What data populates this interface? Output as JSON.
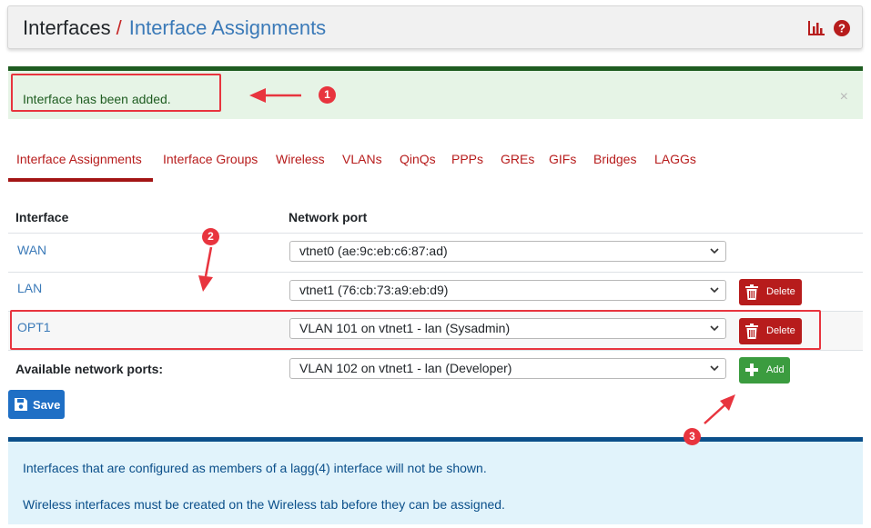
{
  "header": {
    "crumb_root": "Interfaces",
    "crumb_sep": "/",
    "crumb_current": "Interface Assignments"
  },
  "alert": {
    "message": "Interface has been added.",
    "close_glyph": "×"
  },
  "tabs": [
    {
      "label": "Interface Assignments",
      "active": true
    },
    {
      "label": "Interface Groups"
    },
    {
      "label": "Wireless"
    },
    {
      "label": "VLANs"
    },
    {
      "label": "QinQs"
    },
    {
      "label": "PPPs"
    },
    {
      "label": "GREs"
    },
    {
      "label": "GIFs"
    },
    {
      "label": "Bridges"
    },
    {
      "label": "LAGGs"
    }
  ],
  "table": {
    "col_interface": "Interface",
    "col_port": "Network port",
    "rows": [
      {
        "interface": "WAN",
        "port": "vtnet0 (ae:9c:eb:c6:87:ad)"
      },
      {
        "interface": "LAN",
        "port": "vtnet1 (76:cb:73:a9:eb:d9)",
        "action": "Delete"
      },
      {
        "interface": "OPT1",
        "port": "VLAN 101 on vtnet1 - lan (Sysadmin)",
        "action": "Delete"
      }
    ],
    "available_label": "Available network ports:",
    "available_value": "VLAN 102 on vtnet1 - lan (Developer)",
    "add_label": "Add"
  },
  "save_label": "Save",
  "info": {
    "line1": "Interfaces that are configured as members of a lagg(4) interface will not be shown.",
    "line2": "Wireless interfaces must be created on the Wireless tab before they can be assigned."
  },
  "annotations": {
    "badge1": "1",
    "badge2": "2",
    "badge3": "3",
    "color": "#e8343e"
  },
  "colors": {
    "brand_red": "#b71c1c",
    "link_blue": "#3b7ab8",
    "success_green": "#3b9c3f",
    "primary_blue": "#1f6fc5"
  }
}
